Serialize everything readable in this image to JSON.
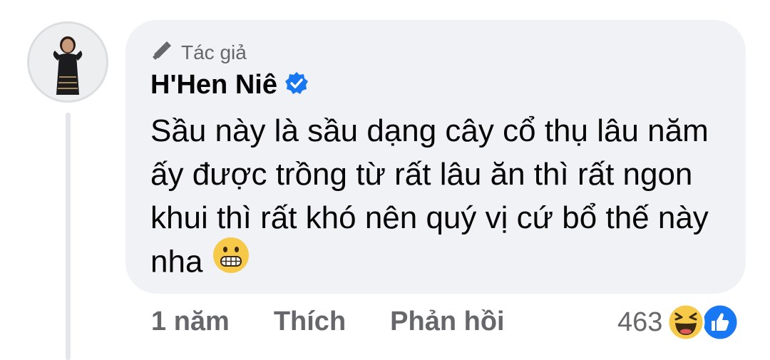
{
  "comment": {
    "author_badge": "Tác giả",
    "author_name": "H'Hen Niê",
    "verified": true,
    "text": "Sầu này là sầu dạng cây cổ thụ lâu năm ấy được trồng từ rất lâu ăn thì rất ngon khui thì rất khó nên quý vị cứ bổ thế này nha",
    "emoji": "grimacing-face-emoji",
    "time": "1 năm",
    "like_label": "Thích",
    "reply_label": "Phản hồi",
    "reaction_count": "463",
    "reactions": [
      "haha-reaction-icon",
      "like-reaction-icon"
    ]
  },
  "colors": {
    "bubble": "#f0f2f5",
    "secondary_text": "#65676b",
    "verified_blue": "#1877f2"
  }
}
